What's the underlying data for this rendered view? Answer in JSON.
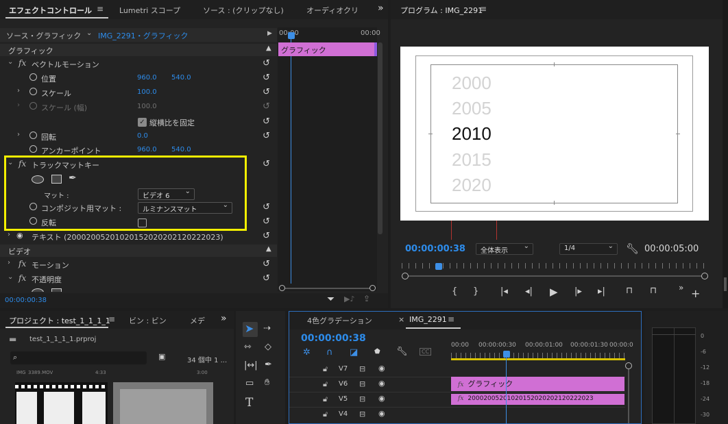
{
  "effect_controls": {
    "tabs": [
      {
        "label": "エフェクトコントロール"
      },
      {
        "label": "Lumetri スコープ"
      },
      {
        "label": "ソース : (クリップなし)"
      },
      {
        "label": "オーディオクリ"
      }
    ],
    "more": "»",
    "source_label": "ソース・グラフィック",
    "clip_label": "IMG_2291・グラフィック",
    "mini_time_start": "00:00",
    "mini_time_end": "00:00",
    "timeline_clip": "グラフィック",
    "section_graphic": "グラフィック",
    "vector_motion": "ベクトルモーション",
    "position": {
      "label": "位置",
      "x": "960.0",
      "y": "540.0"
    },
    "scale": {
      "label": "スケール",
      "value": "100.0"
    },
    "scale_width": {
      "label": "スケール (幅)",
      "value": "100.0"
    },
    "uniform_scale": "縦横比を固定",
    "rotation": {
      "label": "回転",
      "value": "0.0"
    },
    "anchor": {
      "label": "アンカーポイント",
      "x": "960.0",
      "y": "540.0"
    },
    "track_matte": "トラックマットキー",
    "matte": {
      "label": "マット :",
      "value": "ビデオ 6"
    },
    "composite": {
      "label": "コンポジット用マット :",
      "value": "ルミナンスマット"
    },
    "reverse": "反転",
    "text_layer": "テキスト (20002005201020152020202120222023)",
    "section_video": "ビデオ",
    "motion": "モーション",
    "opacity": "不透明度",
    "current_time": "00:00:00:38"
  },
  "program": {
    "title": "プログラム : IMG_2291",
    "years": [
      "2000",
      "2005",
      "2010",
      "2015",
      "2020"
    ],
    "timecode": "00:00:00:38",
    "fit": "全体表示",
    "resolution": "1/4",
    "duration": "00:00:05:00"
  },
  "project": {
    "tabs": [
      {
        "label": "プロジェクト : test_1_1_1_1"
      },
      {
        "label": "ビン : ビン"
      },
      {
        "label": "メデ"
      }
    ],
    "file": "test_1_1_1_1.prproj",
    "item_count": "34 個中 1 ...",
    "thumb_label_left": "IMG_3389.MOV",
    "thumb_label_mid": "4:33",
    "thumb_label_right": "3:00"
  },
  "timeline": {
    "tabs": [
      {
        "label": "4色グラデーション"
      },
      {
        "label": "IMG_2291"
      }
    ],
    "close": "×",
    "timecode": "00:00:00:38",
    "ruler": [
      "00:00",
      "00:00:00:30",
      "00:00:01:00",
      "00:00:01:30",
      "00:00:0"
    ],
    "tracks": [
      "V7",
      "V6",
      "V5",
      "V4"
    ],
    "clip_v6": "グラフィック",
    "clip_v5": "20002005201020152020202120222023"
  },
  "meter": {
    "labels": [
      "0",
      "-6",
      "-12",
      "-18",
      "-24",
      "-30"
    ]
  }
}
